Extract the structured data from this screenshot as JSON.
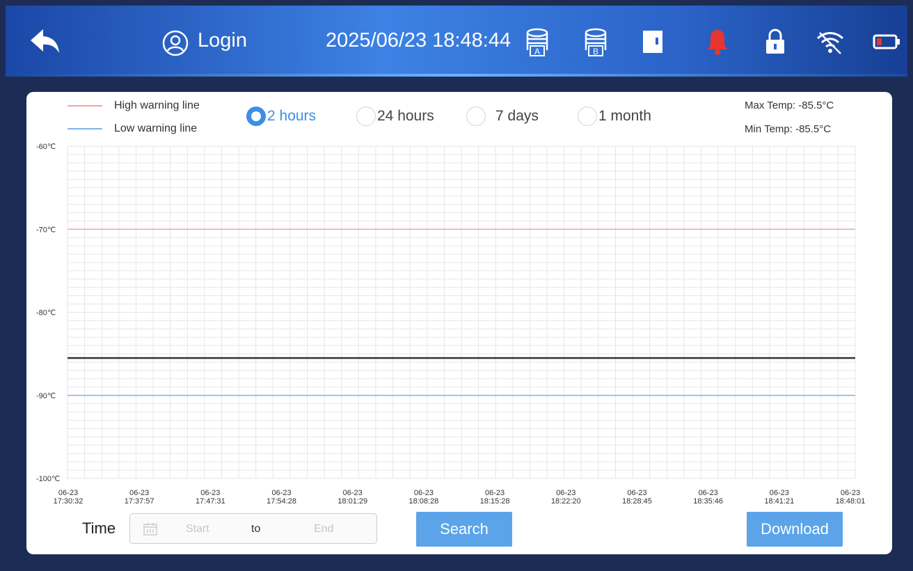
{
  "header": {
    "login_label": "Login",
    "datetime": "2025/06/23 18:48:44",
    "icons": [
      "back-arrow-icon",
      "user-icon",
      "tank-a-icon",
      "tank-b-icon",
      "door-icon",
      "alarm-bell-icon",
      "lock-icon",
      "wifi-icon",
      "battery-icon"
    ],
    "alarm_color": "#e8362f",
    "tank_a_letter": "A",
    "tank_b_letter": "B"
  },
  "legend": {
    "high_label": "High warning line",
    "low_label": "Low warning line",
    "high_color": "#f3a3a6",
    "low_color": "#7fb2ea"
  },
  "range_options": {
    "selected": "2 hours",
    "items": [
      "2 hours",
      "24 hours",
      "7 days",
      "1 month"
    ]
  },
  "stats": {
    "max": "Max Temp: -85.5°C",
    "min": "Min Temp: -85.5°C"
  },
  "chart_data": {
    "type": "line",
    "ylim": [
      -100,
      -60
    ],
    "y_ticks": [
      -60,
      -70,
      -80,
      -90,
      -100
    ],
    "y_tick_labels": [
      "-60℃",
      "-70℃",
      "-80℃",
      "-90℃",
      "-100℃"
    ],
    "x_tick_labels": [
      [
        "06-23",
        "17:30:32"
      ],
      [
        "06-23",
        "17:37:57"
      ],
      [
        "06-23",
        "17:47:31"
      ],
      [
        "06-23",
        "17:54:28"
      ],
      [
        "06-23",
        "18:01:29"
      ],
      [
        "06-23",
        "18:08:28"
      ],
      [
        "06-23",
        "18:15:28"
      ],
      [
        "06-23",
        "18:22:20"
      ],
      [
        "06-23",
        "18:28:45"
      ],
      [
        "06-23",
        "18:35:46"
      ],
      [
        "06-23",
        "18:41:21"
      ],
      [
        "06-23",
        "18:48:01"
      ]
    ],
    "grid": true,
    "series": [
      {
        "name": "High warning line",
        "values": [
          -70,
          -70
        ],
        "color": "#f3a3a6"
      },
      {
        "name": "Low warning line",
        "values": [
          -90,
          -90
        ],
        "color": "#7fb2ea"
      },
      {
        "values": [
          -85.5,
          -85.5
        ],
        "color": "#333333"
      }
    ]
  },
  "filter": {
    "time_label": "Time",
    "start_placeholder": "Start",
    "to_label": "to",
    "end_placeholder": "End",
    "search_label": "Search",
    "download_label": "Download"
  },
  "colors": {
    "accent": "#3d8ee6",
    "button": "#5ba4ea",
    "background": "#1d2c55"
  }
}
